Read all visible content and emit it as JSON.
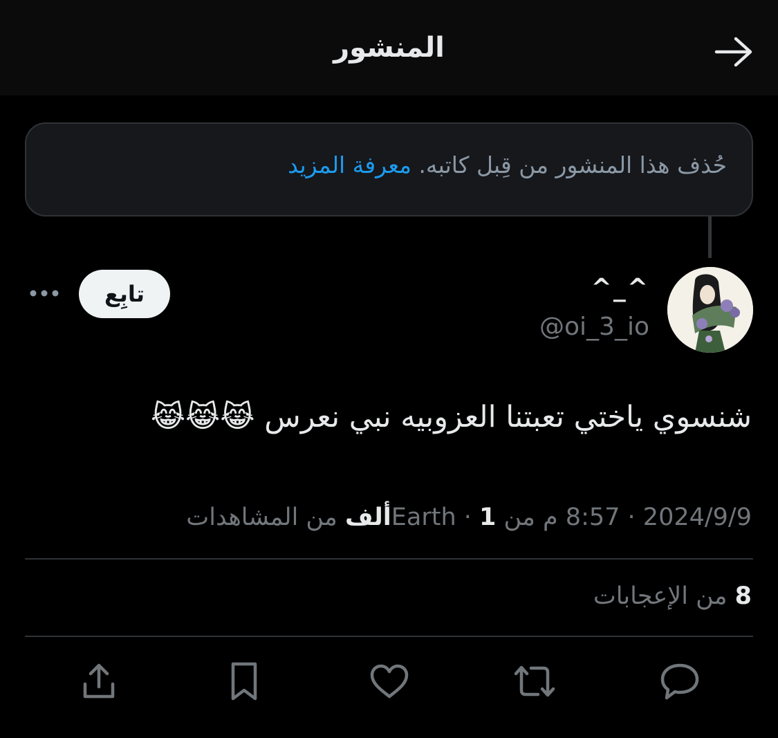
{
  "header": {
    "title": "المنشور",
    "back_icon": "arrow-right-icon"
  },
  "notice": {
    "text": "حُذف هذا المنشور من قِبل كاتبه. ",
    "link": "معرفة المزيد"
  },
  "post": {
    "display_name": "^_^",
    "handle": "@oi_3_io",
    "follow_label": "تابِع",
    "text": "شنسوي ياختي تعبتنا العزوبيه نبي نعرس 😹😹😹",
    "meta_prefix": "2024/9/9 · 8:57 م من Earth · ",
    "views_count": "1ألف",
    "views_suffix": " من المشاهدات",
    "likes_count": "8",
    "likes_suffix": " من الإعجابات"
  },
  "actions": [
    "reply-icon",
    "retweet-icon",
    "like-icon",
    "bookmark-icon",
    "share-icon"
  ],
  "colors": {
    "accent": "#1d9bf0",
    "background": "#000000",
    "muted": "#71767b",
    "text": "#e7e9ea"
  }
}
